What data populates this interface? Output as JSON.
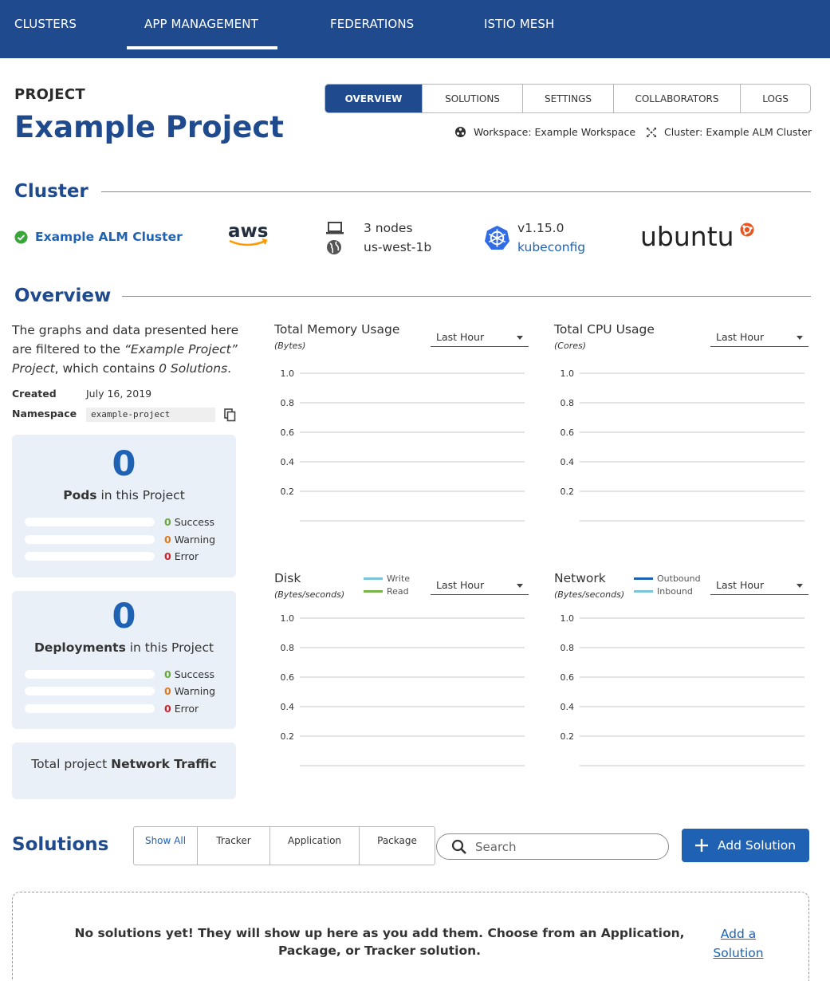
{
  "nav": {
    "tabs": [
      {
        "label": "CLUSTERS"
      },
      {
        "label": "APP MANAGEMENT"
      },
      {
        "label": "FEDERATIONS"
      },
      {
        "label": "ISTIO MESH"
      }
    ],
    "active_tab": "APP MANAGEMENT"
  },
  "project": {
    "label": "PROJECT",
    "title": "Example Project",
    "tabs": [
      {
        "label": "OVERVIEW"
      },
      {
        "label": "SOLUTIONS"
      },
      {
        "label": "SETTINGS"
      },
      {
        "label": "COLLABORATORS"
      },
      {
        "label": "LOGS"
      }
    ],
    "active_tab": "OVERVIEW",
    "workspace": "Workspace: Example Workspace",
    "cluster": "Cluster: Example ALM Cluster"
  },
  "cluster_section": {
    "heading": "Cluster",
    "name": "Example ALM Cluster",
    "provider_logo": "aws",
    "nodes": "3 nodes",
    "region": "us-west-1b",
    "version": "v1.15.0",
    "kubeconfig": "kubeconfig",
    "os_logo": "ubuntu"
  },
  "overview": {
    "heading": "Overview",
    "description": {
      "part1": "The graphs and data presented here are filtered to the ",
      "project_quote": "“Example Project” Project",
      "part2": ", which contains ",
      "solutions_count": "0 Solutions",
      "part3": "."
    },
    "created_label": "Created",
    "created_value": "July 16, 2019",
    "namespace_label": "Namespace",
    "namespace_value": "example-project",
    "pods_card": {
      "count": "0",
      "label_bold": "Pods",
      "label_rest": " in this Project",
      "stats": [
        {
          "count": "0",
          "label": "Success",
          "color": "#6aa73a"
        },
        {
          "count": "0",
          "label": "Warning",
          "color": "#e07a1c"
        },
        {
          "count": "0",
          "label": "Error",
          "color": "#d2232a"
        }
      ]
    },
    "deployments_card": {
      "count": "0",
      "label_bold": "Deployments",
      "label_rest": " in this Project",
      "stats": [
        {
          "count": "0",
          "label": "Success",
          "color": "#6aa73a"
        },
        {
          "count": "0",
          "label": "Warning",
          "color": "#e07a1c"
        },
        {
          "count": "0",
          "label": "Error",
          "color": "#d2232a"
        }
      ]
    },
    "traffic_card": {
      "prefix": "Total project ",
      "bold": "Network Traffic"
    }
  },
  "chart_data": [
    {
      "type": "line",
      "title": "Total Memory Usage",
      "ylabel": "(Bytes)",
      "range": "Last Hour",
      "yticks": [
        "1.0",
        "0.8",
        "0.6",
        "0.4",
        "0.2"
      ],
      "ylim": [
        0,
        1
      ],
      "series": []
    },
    {
      "type": "line",
      "title": "Total CPU Usage",
      "ylabel": "(Cores)",
      "range": "Last Hour",
      "yticks": [
        "1.0",
        "0.8",
        "0.6",
        "0.4",
        "0.2"
      ],
      "ylim": [
        0,
        1
      ],
      "series": []
    },
    {
      "type": "line",
      "title": "Disk",
      "ylabel": "(Bytes/seconds)",
      "range": "Last Hour",
      "yticks": [
        "1.0",
        "0.8",
        "0.6",
        "0.4",
        "0.2"
      ],
      "ylim": [
        0,
        1
      ],
      "series": [
        {
          "name": "Write",
          "color": "#7cc4d8",
          "values": []
        },
        {
          "name": "Read",
          "color": "#78b34a",
          "values": []
        }
      ]
    },
    {
      "type": "line",
      "title": "Network",
      "ylabel": "(Bytes/seconds)",
      "range": "Last Hour",
      "yticks": [
        "1.0",
        "0.8",
        "0.6",
        "0.4",
        "0.2"
      ],
      "ylim": [
        0,
        1
      ],
      "series": [
        {
          "name": "Outbound",
          "color": "#1f62b4",
          "values": []
        },
        {
          "name": "Inbound",
          "color": "#7cc4d8",
          "values": []
        }
      ]
    }
  ],
  "solutions": {
    "heading": "Solutions",
    "filters": [
      {
        "label": "Show All"
      },
      {
        "label": "Tracker"
      },
      {
        "label": "Application"
      },
      {
        "label": "Package"
      }
    ],
    "search_placeholder": "Search",
    "add_button": "Add Solution",
    "empty_message": "No solutions yet! They will show up here as you add them. Choose from an Application, Package, or Tracker solution.",
    "empty_link": "Add a Solution"
  },
  "colors": {
    "brand": "#1f4b8e",
    "accent": "#1f62b4",
    "card_bg": "#e9f0f8"
  }
}
